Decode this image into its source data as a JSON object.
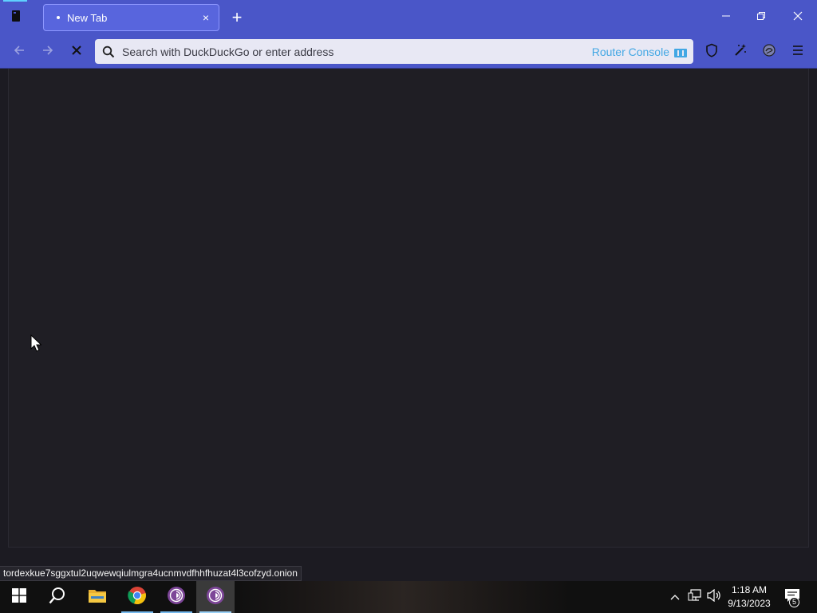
{
  "browser": {
    "tab": {
      "title": "New Tab",
      "close_glyph": "×"
    },
    "new_tab_glyph": "+",
    "urlbar": {
      "placeholder": "Search with DuckDuckGo or enter address",
      "router_console_label": "Router Console"
    },
    "colors": {
      "chrome": "#4a56c8",
      "active_tab": "#5865dd",
      "content_bg": "#1f1e24",
      "router_console": "#42a7e4"
    },
    "icons": {
      "tab_menu": "tab-list-icon",
      "back": "arrow-left-icon",
      "forward": "arrow-right-icon",
      "stop": "stop-x-icon",
      "search": "magnifier-icon",
      "router": "router-console-icon",
      "shield": "shield-icon",
      "magic": "magic-wand-icon",
      "onion": "tor-circuit-icon",
      "menu": "hamburger-icon",
      "minimize": "minimize-icon",
      "restore": "restore-icon",
      "close": "close-icon"
    }
  },
  "status_bar": {
    "text": "tordexkue7sggxtul2uqwewqiulmgra4ucnmvdfhhfhuzat4l3cofzyd.onion"
  },
  "taskbar": {
    "apps": [
      "start",
      "search",
      "file-explorer",
      "chrome",
      "tor-browser",
      "tor-browser-active"
    ],
    "clock_time": "1:18 AM",
    "clock_date": "9/13/2023",
    "notification_count": "5"
  }
}
